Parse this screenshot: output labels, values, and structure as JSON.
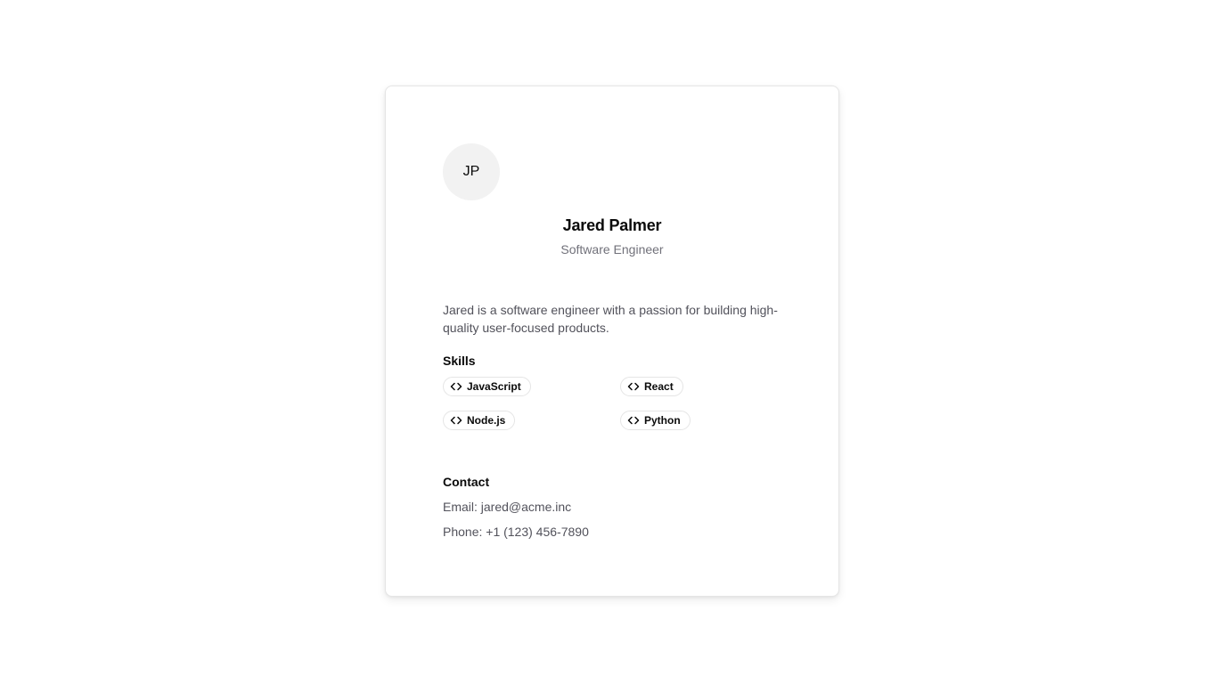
{
  "profile": {
    "initials": "JP",
    "name": "Jared Palmer",
    "role": "Software Engineer",
    "bio": "Jared is a software engineer with a passion for building high-quality user-focused products."
  },
  "skills": {
    "title": "Skills",
    "icon": "code-icon",
    "items": [
      "JavaScript",
      "React",
      "Node.js",
      "Python"
    ]
  },
  "contact": {
    "title": "Contact",
    "email": "Email: jared@acme.inc",
    "phone": "Phone: +1 (123) 456-7890"
  },
  "colors": {
    "card_border": "#e5e5e5",
    "avatar_bg": "#f2f2f2",
    "muted_text": "#71717a",
    "body_text": "#52525b",
    "heading_text": "#0a0a0a"
  }
}
